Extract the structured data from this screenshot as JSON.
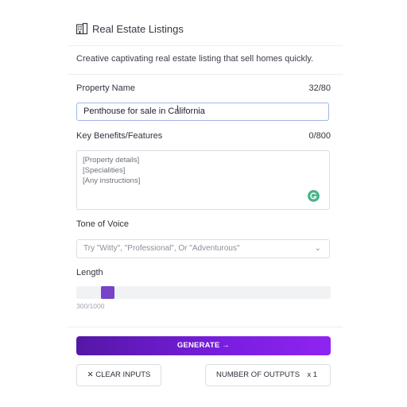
{
  "header": {
    "title": "Real Estate Listings",
    "icon": "building-icon"
  },
  "subtitle": "Creative captivating real estate listing that sell homes quickly.",
  "property_name": {
    "label": "Property Name",
    "counter": "32/80",
    "value": "Penthouse for sale in California"
  },
  "benefits": {
    "label": "Key Benefits/Features",
    "counter": "0/800",
    "placeholder_lines": [
      "[Property details]",
      "[Specialities]",
      "[Any instructions]"
    ]
  },
  "tone": {
    "label": "Tone of Voice",
    "placeholder": "Try \"Witty\", \"Professional\", Or \"Adventurous\""
  },
  "length": {
    "label": "Length",
    "value_text": "300/1000",
    "value": 300,
    "max": 1000
  },
  "actions": {
    "generate_label": "GENERATE",
    "generate_arrow": "→",
    "clear_icon": "✕",
    "clear_label": "CLEAR INPUTS",
    "outputs_label": "NUMBER OF OUTPUTS",
    "outputs_value": "x 1"
  },
  "colors": {
    "accent": "#7743c8",
    "button_start": "#5417a6",
    "button_end": "#8f24f0",
    "grammarly": "#48b38a"
  }
}
